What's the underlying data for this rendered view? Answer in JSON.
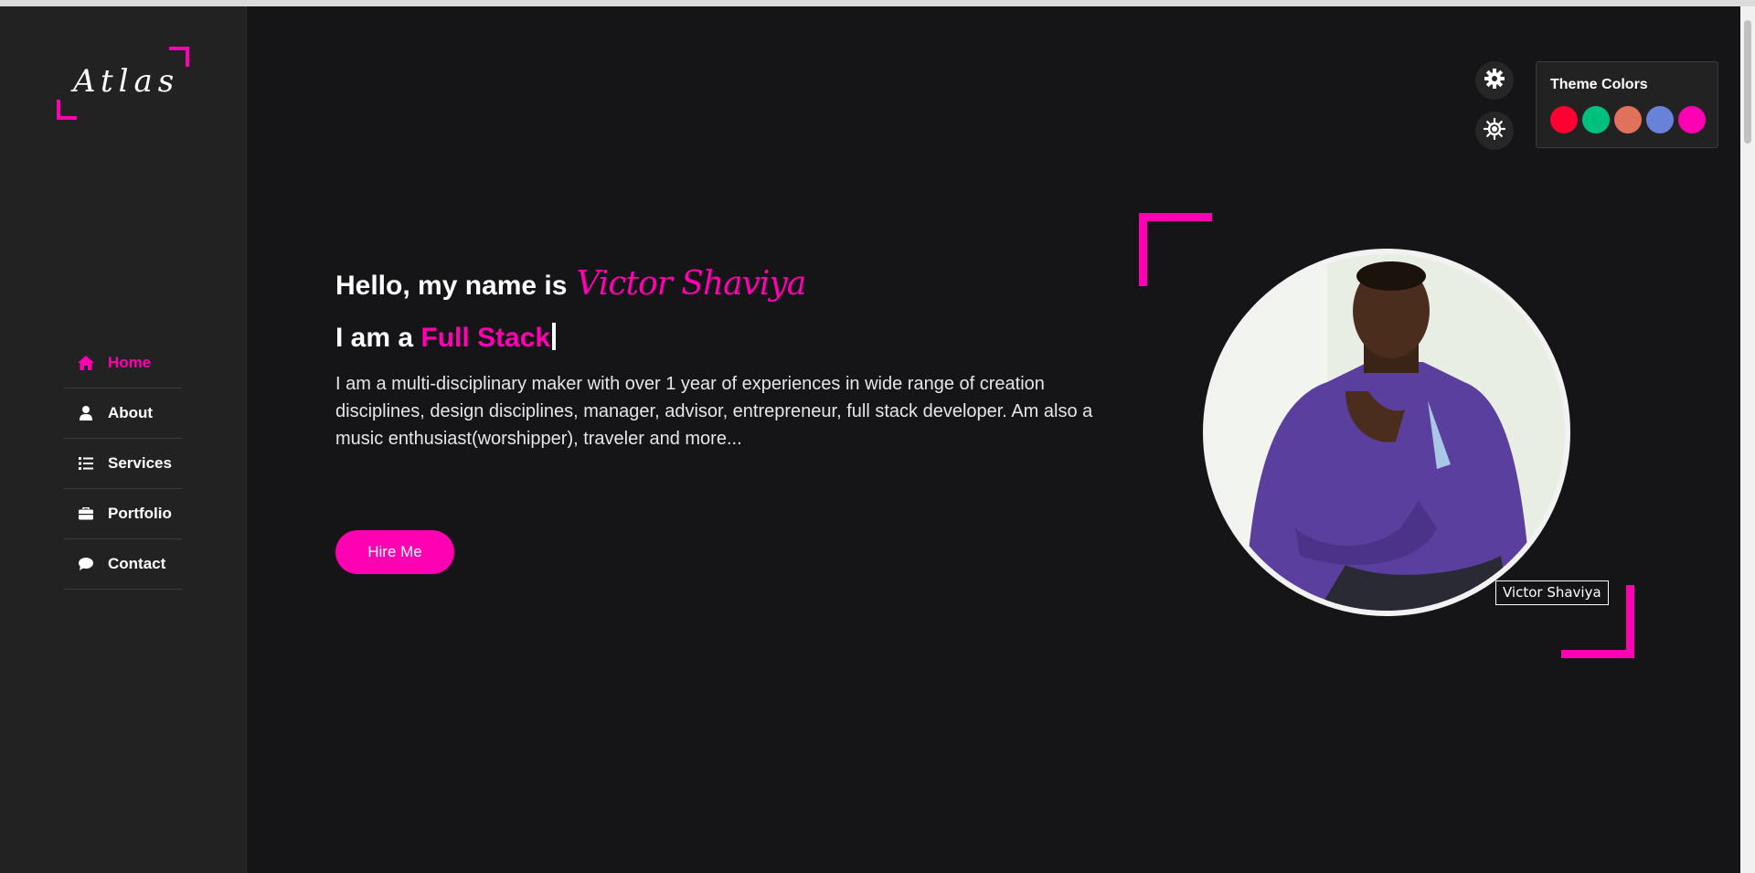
{
  "theme": {
    "accent": "#ff00b3",
    "background": "#151416",
    "sidebar": "#222222"
  },
  "sidebar": {
    "logo": "Atlas",
    "nav": [
      {
        "label": "Home",
        "icon": "home-icon",
        "active": true
      },
      {
        "label": "About",
        "icon": "user-icon",
        "active": false
      },
      {
        "label": "Services",
        "icon": "list-icon",
        "active": false
      },
      {
        "label": "Portfolio",
        "icon": "briefcase-icon",
        "active": false
      },
      {
        "label": "Contact",
        "icon": "chat-icon",
        "active": false
      }
    ]
  },
  "hero": {
    "greeting": "Hello, my name is",
    "name": "Victor Shaviya",
    "role_prefix": "I am a",
    "role": "Full Stack",
    "bio": "I am a multi-disciplinary maker with over 1 year of experiences in wide range of creation disciplines, design disciplines, manager, advisor, entrepreneur, full stack developer. Am also a music enthusiast(worshipper), traveler and more...",
    "cta": "Hire Me",
    "image_tooltip": "Victor Shaviya"
  },
  "controls": {
    "settings_icon": "gear-icon",
    "theme_icon": "sun-icon"
  },
  "theme_panel": {
    "title": "Theme Colors",
    "colors": [
      "#fe0032",
      "#00c07e",
      "#e0715a",
      "#6782d8",
      "#ff00b3"
    ]
  }
}
